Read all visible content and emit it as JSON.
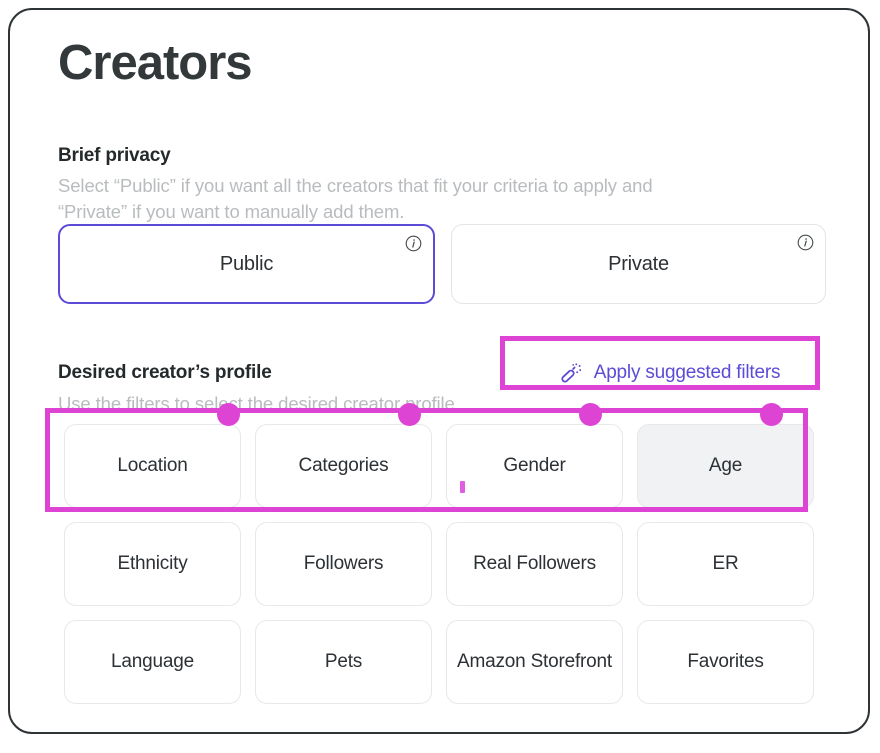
{
  "page": {
    "title": "Creators"
  },
  "brief_privacy": {
    "heading": "Brief privacy",
    "description": "Select “Public” if you want all the creators that fit your criteria to apply and\n“Private” if you want to manually add them.",
    "options": [
      {
        "label": "Public",
        "selected": true,
        "info_icon": "info-circle-icon"
      },
      {
        "label": "Private",
        "selected": false,
        "info_icon": "info-circle-icon"
      }
    ]
  },
  "desired_profile": {
    "heading": "Desired creator’s profile",
    "description": "Use the filters to select the desired creator profile.",
    "apply_suggested": {
      "label": "Apply suggested filters",
      "icon": "magic-wand-icon"
    },
    "filters": [
      {
        "label": "Location",
        "hovered": false
      },
      {
        "label": "Categories",
        "hovered": false
      },
      {
        "label": "Gender",
        "hovered": false
      },
      {
        "label": "Age",
        "hovered": true
      },
      {
        "label": "Ethnicity",
        "hovered": false
      },
      {
        "label": "Followers",
        "hovered": false
      },
      {
        "label": "Real Followers",
        "hovered": false
      },
      {
        "label": "ER",
        "hovered": false
      },
      {
        "label": "Language",
        "hovered": false
      },
      {
        "label": "Pets",
        "hovered": false
      },
      {
        "label": "Amazon Storefront",
        "hovered": false
      },
      {
        "label": "Favorites",
        "hovered": false
      }
    ]
  },
  "colors": {
    "accent_purple": "#5b4bd6",
    "annotation_magenta": "#dd44d4",
    "card_border": "#2f3437",
    "muted_text": "#b9bcbe",
    "chip_hover_bg": "#f1f2f3"
  }
}
